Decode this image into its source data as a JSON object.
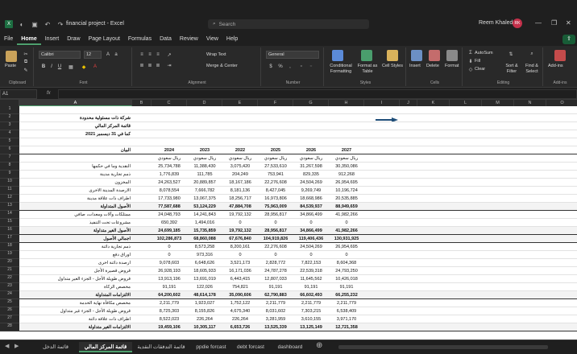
{
  "window": {
    "title": "financial project - Excel",
    "search_placeholder": "Search",
    "user_name": "Reem Khaled",
    "user_initials": "RK"
  },
  "menu": {
    "tabs": [
      "File",
      "Home",
      "Insert",
      "Draw",
      "Page Layout",
      "Formulas",
      "Data",
      "Review",
      "View",
      "Help"
    ],
    "active": "Home"
  },
  "ribbon": {
    "paste_label": "Paste",
    "font_name": "Calibri",
    "font_size": "12",
    "wrap_text": "Wrap Text",
    "merge_center": "Merge & Center",
    "number_format": "General",
    "conditional_formatting": "Conditional Formatting",
    "format_as_table": "Format as Table",
    "cell_styles": "Cell Styles",
    "insert": "Insert",
    "delete": "Delete",
    "format": "Format",
    "autosum": "AutoSum",
    "fill": "Fill",
    "clear": "Clear",
    "sort_filter": "Sort & Filter",
    "find_select": "Find & Select",
    "add_ins": "Add-ins",
    "groups": [
      "Clipboard",
      "Font",
      "Alignment",
      "Number",
      "Styles",
      "Cells",
      "Editing",
      "Add-ins"
    ]
  },
  "formula_bar": {
    "name_box": "A1",
    "fx": "fx",
    "formula": ""
  },
  "columns": [
    "A",
    "B",
    "C",
    "D",
    "E",
    "F",
    "G",
    "H",
    "I",
    "J",
    "K",
    "L",
    "M",
    "N",
    "O",
    "P",
    "Q"
  ],
  "selected_column": "A",
  "title_lines": [
    "شركة ذات مسئولية محدودة",
    "قائمة المركز المالي",
    "كما في 31 ديسمبر 2021"
  ],
  "year_header": {
    "label": "البيان",
    "years": [
      "2024",
      "2023",
      "2022",
      "2025",
      "2026",
      "2027"
    ]
  },
  "currency_row": [
    "ريال سعودي",
    "ريال سعودي",
    "ريال سعودي",
    "ريال سعودي",
    "ريال سعودي",
    "ريال سعودي"
  ],
  "rows": [
    {
      "n": "8",
      "label": "النقدية وما في حكمها",
      "v": [
        "25,734,788",
        "11,388,430",
        "3,075,420",
        "27,533,610",
        "31,267,598",
        "30,350,086"
      ]
    },
    {
      "n": "9",
      "label": "ذمم تجارية مدينة",
      "v": [
        "1,776,839",
        "111,785",
        "204,249",
        "753,941",
        "829,335",
        "912,268"
      ]
    },
    {
      "n": "10",
      "label": "المخزون",
      "v": [
        "24,263,527",
        "20,889,857",
        "18,167,186",
        "22,276,608",
        "24,504,269",
        "26,954,695"
      ]
    },
    {
      "n": "11",
      "label": "الارصدة المدينة الاخرى",
      "v": [
        "8,078,554",
        "7,666,782",
        "8,181,136",
        "8,427,045",
        "9,269,749",
        "10,196,724"
      ]
    },
    {
      "n": "12",
      "label": "اطراف ذات علاقة مدينة",
      "v": [
        "17,733,980",
        "13,067,375",
        "18,256,717",
        "16,973,806",
        "18,668,986",
        "20,535,885"
      ]
    },
    {
      "n": "13",
      "label": "الأصول المتداولة",
      "v": [
        "77,587,688",
        "53,124,229",
        "47,884,708",
        "75,963,009",
        "84,539,937",
        "88,949,659"
      ],
      "bold": true,
      "hl": true
    },
    {
      "n": "14",
      "label": "ممتلكات وآلات ومعدات، صافي",
      "v": [
        "24,048,793",
        "14,241,843",
        "19,792,132",
        "28,956,817",
        "34,866,499",
        "41,982,266"
      ]
    },
    {
      "n": "15",
      "label": "مشروعات تحت التنفيذ",
      "v": [
        "650,392",
        "1,494,016",
        "0",
        "0",
        "0",
        "0"
      ]
    },
    {
      "n": "16",
      "label": "الأصول الغير متداولة",
      "v": [
        "24,699,185",
        "15,735,859",
        "19,792,132",
        "28,956,817",
        "34,866,499",
        "41,982,266"
      ],
      "bold": true,
      "hl": true
    },
    {
      "n": "17",
      "label": "اجمالي الأصول",
      "v": [
        "102,286,873",
        "68,860,088",
        "67,676,840",
        "104,919,826",
        "119,406,436",
        "130,931,925"
      ],
      "bold": true,
      "hl": true
    },
    {
      "n": "18",
      "label": "ذمم تجارية دائنة",
      "v": [
        "14,189,419",
        "0",
        "8,573,258",
        "8,200,161",
        "22,276,608",
        "24,504,269",
        "26,954,695"
      ]
    },
    {
      "n": "19",
      "label": "اوراق دفع",
      "v": [
        "0",
        "973,316",
        "0",
        "0",
        "0",
        "0"
      ]
    },
    {
      "n": "20",
      "label": "ارصدة دائنة اخرى",
      "v": [
        "9,078,603",
        "6,648,626",
        "3,521,173",
        "2,828,772",
        "7,822,153",
        "8,604,368"
      ]
    },
    {
      "n": "21",
      "label": "قروض قصيرة الأجل",
      "v": [
        "26,928,193",
        "18,605,933",
        "16,171,036",
        "24,787,278",
        "22,539,318",
        "24,793,250"
      ]
    },
    {
      "n": "22",
      "label": "قروض طويلة الأجل - الجزء الغير متداول",
      "v": [
        "13,913,196",
        "13,691,019",
        "6,443,415",
        "12,807,033",
        "11,645,562",
        "10,426,018"
      ]
    },
    {
      "n": "23",
      "label": "مخصص الزكاة",
      "v": [
        "91,191",
        "122,026",
        "754,821",
        "91,191",
        "91,191",
        "91,191"
      ]
    },
    {
      "n": "24",
      "label": "الالتزامات المتداولة",
      "v": [
        "64,200,602",
        "48,614,178",
        "35,090,606",
        "62,790,883",
        "66,602,493",
        "66,255,232"
      ],
      "bold": true,
      "hl": true
    },
    {
      "n": "25",
      "label": "مخصص مكافأة نهاية الخدمة",
      "v": [
        "2,211,779",
        "1,923,027",
        "1,752,122",
        "2,211,779",
        "2,211,779",
        "2,211,779"
      ]
    },
    {
      "n": "26",
      "label": "قروض طويلة الأجل - الجزء غير متداول",
      "v": [
        "8,725,303",
        "8,155,826",
        "4,675,340",
        "8,031,602",
        "7,303,215",
        "6,538,409"
      ]
    },
    {
      "n": "27",
      "label": "اطراف ذات علاقة دائنة",
      "v": [
        "8,522,023",
        "226,264",
        "226,264",
        "3,281,959",
        "3,610,155",
        "3,971,170"
      ]
    },
    {
      "n": "28",
      "label": "الالتزامات الغير متداولة",
      "v": [
        "19,459,106",
        "10,305,117",
        "6,653,726",
        "13,525,339",
        "13,125,149",
        "12,721,358"
      ],
      "bold": true,
      "hl": true
    }
  ],
  "sheet_tabs": [
    "قائمة الدخل",
    "قائمة المركز المالي",
    "قائمة التدفقات النقدية",
    "ppdie forcast",
    "debt forcast",
    "dashboard"
  ],
  "active_sheet": "قائمة المركز المالي",
  "colors": {
    "accent": "#4ea06e",
    "share": "#185c37",
    "arrow": "#1f4e79"
  }
}
